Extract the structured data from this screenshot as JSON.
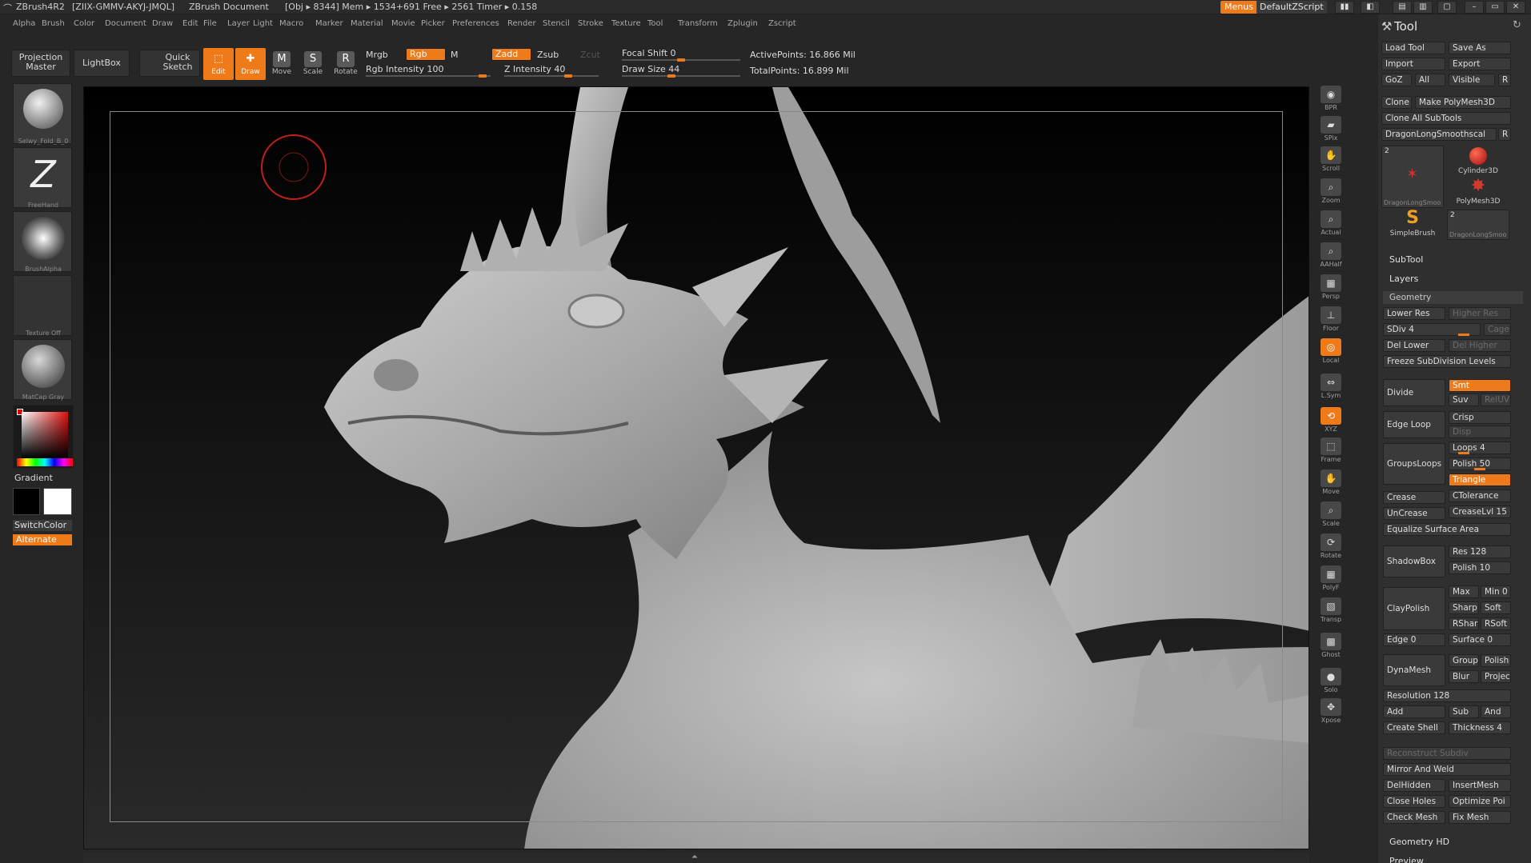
{
  "titlebar": {
    "app": "ZBrush4R2",
    "serial": "[ZIIX-GMMV-AKYJ-JMQL]",
    "doc": "ZBrush Document",
    "stats": "[Obj ▸ 8344]  Mem ▸ 1534+691  Free ▸ 2561  Timer ▸ 0.158",
    "menus": "Menus",
    "script": "DefaultZScript"
  },
  "menubar": [
    "Alpha",
    "Brush",
    "Color",
    "Document",
    "Draw",
    "Edit",
    "File",
    "Layer",
    "Light",
    "Macro",
    "Marker",
    "Material",
    "Movie",
    "Picker",
    "Preferences",
    "Render",
    "Stencil",
    "Stroke",
    "Texture",
    "Tool",
    "Transform",
    "Zplugin",
    "Zscript"
  ],
  "toolbar": {
    "projection_master": "Projection Master",
    "lightbox": "LightBox",
    "quick_sketch": "Quick Sketch",
    "edit": "Edit",
    "draw": "Draw",
    "move": "Move",
    "scale": "Scale",
    "rotate": "Rotate",
    "mrgb": "Mrgb",
    "rgb": "Rgb",
    "m": "M",
    "zadd": "Zadd",
    "zsub": "Zsub",
    "zcut": "Zcut",
    "rgb_intensity": "Rgb  Intensity 100",
    "z_intensity": "Z  Intensity 40",
    "focal_shift": "Focal Shift 0",
    "draw_size": "Draw Size 44",
    "active_points": "ActivePoints: 16.866  Mil",
    "total_points": "TotalPoints: 16.899  Mil"
  },
  "leftshelf": {
    "brush": "Selwy_Fold_B_0",
    "stroke": "FreeHand",
    "alpha": "BrushAlpha",
    "texture": "Texture Off",
    "material": "MatCap Gray",
    "gradient": "Gradient",
    "switchcolor": "SwitchColor",
    "alternate": "Alternate"
  },
  "rightshelf": [
    "BPR",
    "SPix",
    "Scroll",
    "Zoom",
    "Actual",
    "AAHalf",
    "Persp",
    "Floor",
    "Local",
    "L.Sym",
    "XYZ",
    "Frame",
    "Move",
    "Scale",
    "Rotate",
    "PolyF",
    "Transp",
    "Ghost",
    "Solo",
    "Xpose"
  ],
  "toolpanel": {
    "title": "Tool",
    "load_tool": "Load Tool",
    "save_as": "Save As",
    "import": "Import",
    "export": "Export",
    "goz": "GoZ",
    "all": "All",
    "visible": "Visible",
    "r": "R",
    "clone": "Clone",
    "make_polymesh": "Make PolyMesh3D",
    "clone_all": "Clone  All  SubTools",
    "current_tool": "DragonLongSmoothscal",
    "tools": {
      "t1_count": "2",
      "t1_name": "DragonLongSmoo",
      "t2_name": "Cylinder3D",
      "t3_name": "PolyMesh3D",
      "t4_name": "SimpleBrush",
      "t5_count": "2",
      "t5_name": "DragonLongSmoo"
    },
    "subtool": "SubTool",
    "layers": "Layers",
    "geometry": "Geometry",
    "lower_res": "Lower Res",
    "higher_res": "Higher Res",
    "sdiv": "SDiv 4",
    "cage": "Cage",
    "del_lower": "Del Lower",
    "del_higher": "Del Higher",
    "freeze": "Freeze SubDivision Levels",
    "divide": "Divide",
    "smt": "Smt",
    "suv": "Suv",
    "reluv": "RelUV",
    "edge_loop": "Edge Loop",
    "crisp": "Crisp",
    "disp": "Disp",
    "groupsloops": "GroupsLoops",
    "loops": "Loops 4",
    "polish": "Polish 50",
    "triangle": "Triangle",
    "crease": "Crease",
    "ctolerance": "CTolerance",
    "uncrease": "UnCrease",
    "creaselvl": "CreaseLvl 15",
    "equalize": "Equalize Surface Area",
    "shadowbox": "ShadowBox",
    "res": "Res 128",
    "polish10": "Polish 10",
    "claypolish": "ClayPolish",
    "max": "Max",
    "min": "Min 0",
    "sharp": "Sharp",
    "soft": "Soft",
    "rshar": "RShar",
    "rsoft": "RSoft",
    "edge": "Edge 0",
    "surface": "Surface 0",
    "dynamesh": "DynaMesh",
    "group": "Group",
    "polish_dm": "Polish",
    "blur": "Blur",
    "project": "Projec",
    "resolution": "Resolution 128",
    "add": "Add",
    "sub": "Sub",
    "and": "And",
    "create_shell": "Create Shell",
    "thickness": "Thickness 4",
    "reconstruct": "Reconstruct  Subdiv",
    "mirror_weld": "Mirror And Weld",
    "delhidden": "DelHidden",
    "insertmesh": "InsertMesh",
    "close_holes": "Close Holes",
    "optimize": "Optimize Poi",
    "check_mesh": "Check Mesh",
    "fix_mesh": "Fix Mesh",
    "geometry_hd": "Geometry HD",
    "preview": "Preview"
  }
}
